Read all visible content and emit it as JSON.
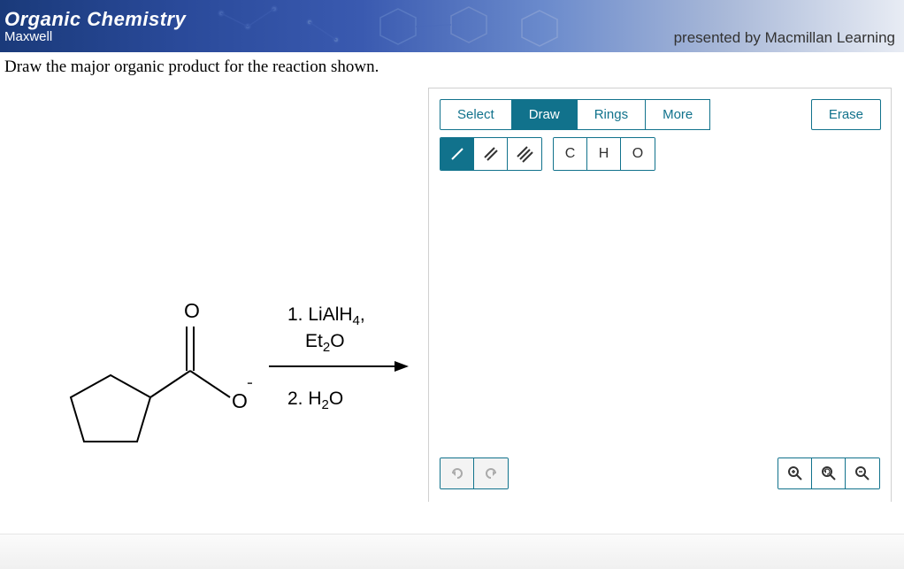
{
  "header": {
    "title": "Organic Chemistry",
    "subtitle": "Maxwell",
    "presented": "presented by Macmillan Learning"
  },
  "question": "Draw the major organic product for the reaction shown.",
  "reaction": {
    "step1_label": "1. LiAlH",
    "step1_sub": "4",
    "step1_suffix": ",",
    "step1b_label": "Et",
    "step1b_sub": "2",
    "step1b_suffix": "O",
    "step2_label": "2. H",
    "step2_sub": "2",
    "step2_suffix": "O"
  },
  "toolbar": {
    "select": "Select",
    "draw": "Draw",
    "rings": "Rings",
    "more": "More",
    "erase": "Erase"
  },
  "atoms": {
    "c": "C",
    "h": "H",
    "o": "O"
  }
}
